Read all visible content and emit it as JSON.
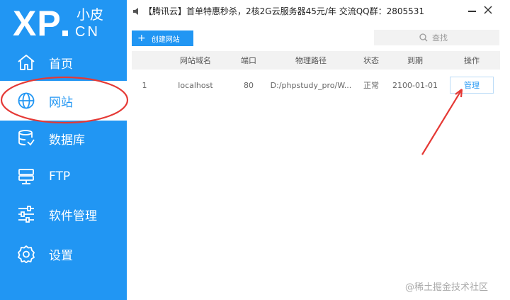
{
  "logo": {
    "main": "XP",
    "cn_small": "小皮",
    "cn_domain": "CN"
  },
  "sidebar": {
    "items": [
      {
        "label": "首页",
        "icon": "home-icon"
      },
      {
        "label": "网站",
        "icon": "globe-icon",
        "active": true
      },
      {
        "label": "数据库",
        "icon": "database-icon"
      },
      {
        "label": "FTP",
        "icon": "ftp-icon"
      },
      {
        "label": "软件管理",
        "icon": "sliders-icon"
      },
      {
        "label": "设置",
        "icon": "gear-icon"
      }
    ]
  },
  "topbar": {
    "ad_text": "【腾讯云】首单特惠秒杀，2核2G云服务器45元/年 交流QQ群：2805531"
  },
  "toolbar": {
    "create_label": "创建网站",
    "search_placeholder": "查找"
  },
  "table": {
    "headers": [
      "网站域名",
      "端口",
      "物理路径",
      "状态",
      "到期",
      "操作"
    ],
    "rows": [
      {
        "index": "1",
        "domain": "localhost",
        "port": "80",
        "path": "D:/phpstudy_pro/W...",
        "status": "正常",
        "expire": "2100-01-01",
        "action": "管理"
      }
    ]
  },
  "watermark": "@稀土掘金技术社区",
  "colors": {
    "accent": "#2196f3",
    "annotation": "#e53935"
  }
}
